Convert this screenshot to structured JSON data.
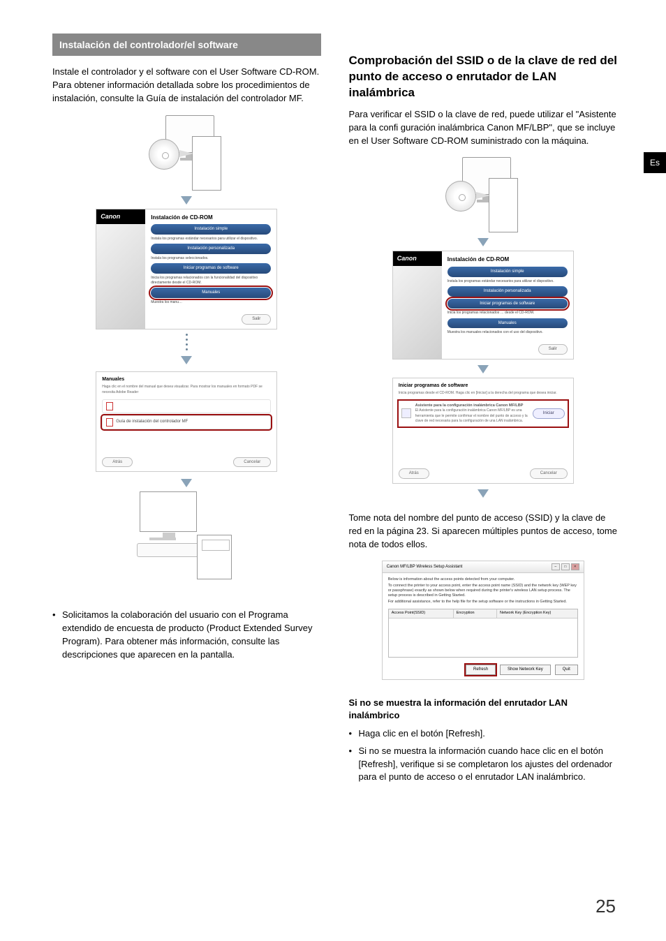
{
  "lang_tab": "Es",
  "page_number": "25",
  "left": {
    "section_header": "Instalación del controlador/el software",
    "intro": "Instale el controlador y el software con el User Software CD-ROM. Para obtener información detallada sobre los procedimientos de instalación, consulte la Guía de instalación del controlador MF.",
    "installer": {
      "brand": "Canon",
      "title": "Instalación de CD-ROM",
      "btn_simple": "Instalación simple",
      "desc_simple": "Instala los programas estándar necesarios para utilizar el dispositivo.",
      "btn_custom": "Instalación personalizada",
      "desc_custom": "Instala los programas seleccionados.",
      "btn_start_sw": "Iniciar programas de software",
      "desc_start_sw": "Inicia los programas relacionados con la funcionalidad del dispositivo directamente desde el CD-ROM.",
      "btn_manuals": "Manuales",
      "desc_manuals": "Muestra los manu…",
      "exit": "Salir"
    },
    "manuals_panel": {
      "title": "Manuales",
      "desc": "Haga clic en el nombre del manual que desea visualizar. Para mostrar los manuales en formato PDF se necesita Adobe Reader",
      "item1": "Guía de instalación del controlador MF",
      "back": "Atrás",
      "cancel": "Cancelar"
    },
    "footnote": "Solicitamos la colaboración del usuario con el Programa extendido de encuesta de producto (Product Extended Survey Program). Para obtener más información, consulte las descripciones que aparecen en la pantalla."
  },
  "right": {
    "h2": "Comprobación del SSID o de la clave de red del punto de acceso o enrutador de LAN inalámbrica",
    "intro": "Para verificar el SSID o la clave de red, puede utilizar el \"Asistente para la confi guración inalámbrica Canon MF/LBP\", que se incluye en el User Software CD-ROM suministrado con la máquina.",
    "installer": {
      "brand": "Canon",
      "title": "Instalación de CD-ROM",
      "btn_simple": "Instalación simple",
      "desc_simple": "Instala los programas estándar necesarios para utilizar el dispositivo.",
      "btn_custom": "Instalación personalizada",
      "btn_start_sw": "Iniciar programas de software",
      "desc_start_sw": "Inicia los programas relacionados … desde el CD-ROM.",
      "btn_manuals": "Manuales",
      "desc_manuals": "Muestra los manuales relacionados con el uso del dispositivo.",
      "exit": "Salir"
    },
    "prog_panel": {
      "title": "Iniciar programas de software",
      "desc": "Inicia programas desde el CD-ROM. Haga clic en [Iniciar] a la derecha del programa que desea iniciar.",
      "row1_t": "Asistente para la configuración inalámbrica Canon MF/LBP",
      "row1_d": "El Asistente para la configuración inalámbrica Canon MF/LBP es una herramienta que le permite confirmar el nombre del punto de acceso y la clave de red necesaria para la configuración de una LAN inalámbrica.",
      "iniciar": "Iniciar",
      "back": "Atrás",
      "cancel": "Cancelar"
    },
    "note": "Tome nota del nombre del punto de acceso (SSID) y la clave de red en la página 23. Si aparecen múltiples puntos de acceso, tome nota de todos ellos.",
    "wassist": {
      "title": "Canon MF/LBP Wireless Setup Assistant",
      "p1": "Below is information about the access points detected from your computer.",
      "p2": "To connect the printer to your access point, enter the access point name (SSID) and the network key (WEP key or passphrase) exactly as shown below when required during the printer's wireless LAN setup process. The setup process is described in Getting Started.",
      "p3": "For additional assistance, refer to the help file for the setup software or the instructions in Getting Started.",
      "col1": "Access Point(SSID)",
      "col2": "Encryption",
      "col3": "Network Key (Encryption Key)",
      "refresh": "Refresh",
      "shownk": "Show Network Key",
      "quit": "Quit"
    },
    "subhead": "Si no se muestra la información del enrutador LAN inalámbrico",
    "b1": "Haga clic en el botón [Refresh].",
    "b2": "Si no se muestra la información cuando hace clic en el botón [Refresh], verifique si se completaron los ajustes del ordenador para el punto de acceso o el enrutador LAN inalámbrico."
  }
}
